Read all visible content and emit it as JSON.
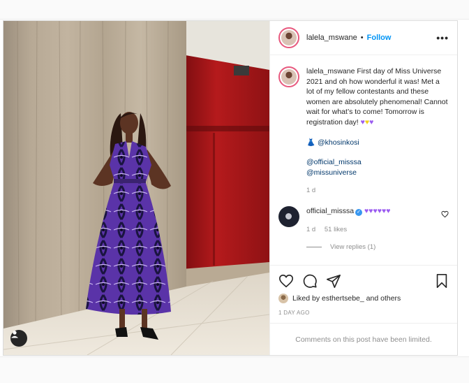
{
  "post": {
    "author": "lalela_mswane",
    "follow_label": "Follow",
    "separator": "•",
    "more_icon": "more-options-icon",
    "caption": "First day of Miss Universe 2021 and oh how wonderful it was! Met a lot of my fellow contestants and these women are absolutely phenomenal! Cannot wait for what’s to come! Tomorrow is registration day!",
    "caption_hearts_1": "♥",
    "caption_heart_yellow": "♥",
    "caption_hearts_2": "♥",
    "dress_emoji": "👗",
    "mention_stylist": "@khosinkosi",
    "mention_org": "@official_misssa",
    "mention_miss_universe": "@missuniverse",
    "caption_age": "1 d",
    "reply": {
      "user": "official_misssa",
      "text": "♥♥♥♥♥♥",
      "age": "1 d",
      "likes": "51 likes",
      "view_replies": "View replies (1)"
    },
    "liked_by_prefix": "Liked by ",
    "liked_by_user": "esthertsebe_",
    "liked_by_suffix": " and others",
    "timestamp": "1 DAY AGO",
    "comments_limited": "Comments on this post have been limited."
  },
  "colors": {
    "follow": "#0095f6",
    "purple_heart": "#9b5cf0",
    "yellow_heart": "#f3d21a",
    "muted": "#8e8e8e",
    "text": "#262626",
    "verified": "#3897f0"
  },
  "icons": [
    "more-options-icon",
    "heart-icon",
    "comment-icon",
    "share-icon",
    "bookmark-icon",
    "user-tag-icon",
    "verified-icon"
  ]
}
